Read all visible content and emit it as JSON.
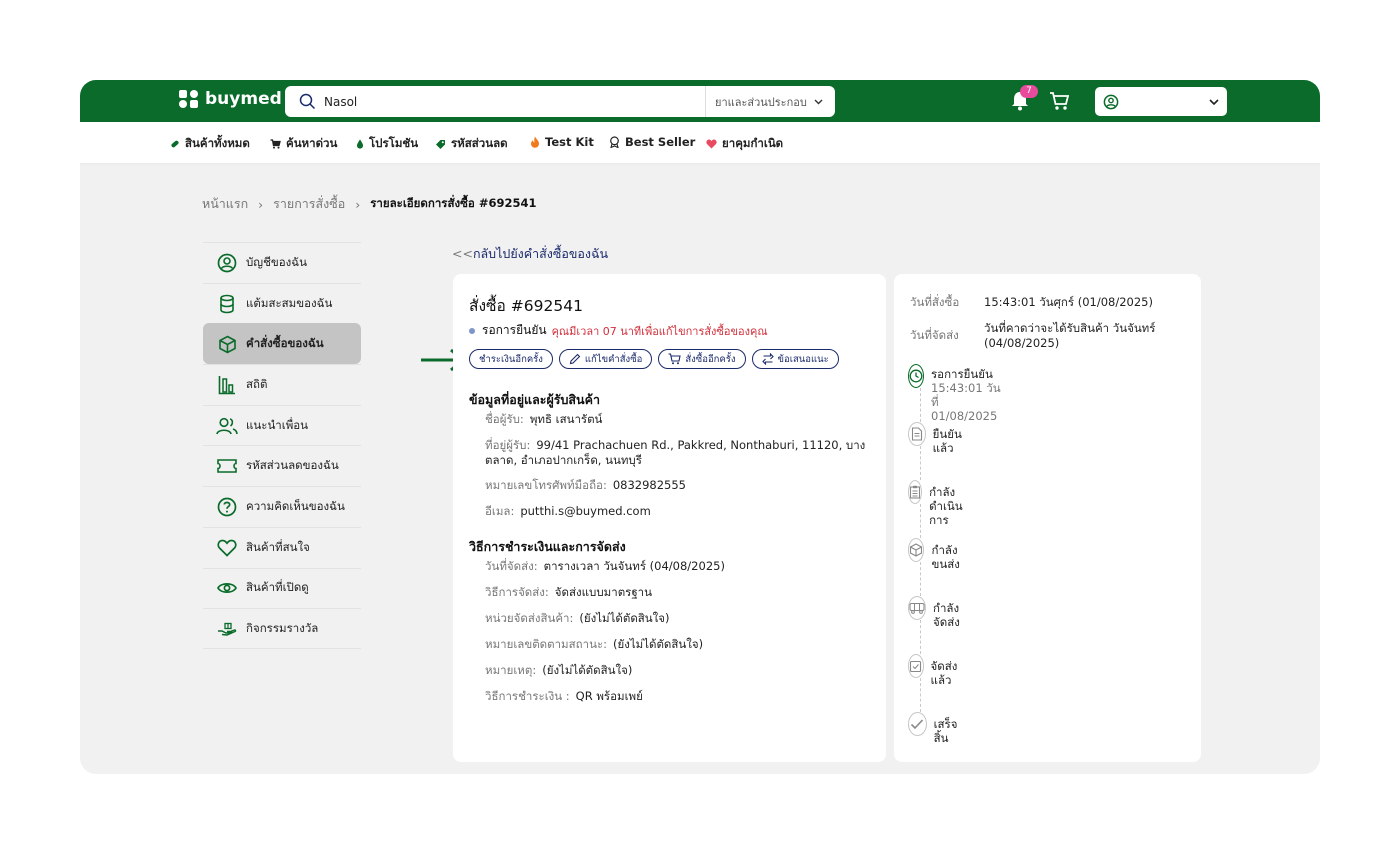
{
  "header": {
    "logo_text": "buymed",
    "search_value": "Nasol",
    "search_category": "ยาและส่วนประกอบ",
    "notification_count": "7"
  },
  "nav": {
    "items": [
      {
        "label": "สินค้าทั้งหมด",
        "icon": "pill-icon"
      },
      {
        "label": "ค้นหาด่วน",
        "icon": "cart-icon"
      },
      {
        "label": "โปรโมชัน",
        "icon": "drop-icon"
      },
      {
        "label": "รหัสส่วนลด",
        "icon": "coupon-icon"
      },
      {
        "label": "Test Kit",
        "icon": "fire-icon"
      },
      {
        "label": "Best Seller",
        "icon": "medal-icon"
      },
      {
        "label": "ยาคุมกำเนิด",
        "icon": "heart-icon"
      }
    ]
  },
  "breadcrumb": {
    "home": "หน้าแรก",
    "orders": "รายการสั่งซื้อ",
    "current": "รายละเอียดการสั่งซื้อ #692541"
  },
  "sidebar": {
    "items": [
      {
        "label": "บัญชีของฉัน",
        "icon": "user-icon"
      },
      {
        "label": "แต้มสะสมของฉัน",
        "icon": "coins-icon"
      },
      {
        "label": "คำสั่งซื้อของฉัน",
        "icon": "box-icon",
        "active": true
      },
      {
        "label": "สถิติ",
        "icon": "chart-icon"
      },
      {
        "label": "แนะนำเพื่อน",
        "icon": "users-icon"
      },
      {
        "label": "รหัสส่วนลดของฉัน",
        "icon": "ticket-icon"
      },
      {
        "label": "ความคิดเห็นของฉัน",
        "icon": "question-icon"
      },
      {
        "label": "สินค้าที่สนใจ",
        "icon": "heart-icon"
      },
      {
        "label": "สินค้าที่เปิดดู",
        "icon": "eye-icon"
      },
      {
        "label": "กิจกรรมรางวัล",
        "icon": "gift-hand-icon"
      }
    ]
  },
  "back_link": {
    "prefix": "<<",
    "label": "กลับไปยังคำสั่งซื้อของฉัน"
  },
  "order": {
    "title": "สั่งซื้อ #692541",
    "status": "รอการยืนยัน",
    "status_note": "คุณมีเวลา 07 นาทีเพื่อแก้ไขการสั่งซื้อของคุณ",
    "actions": {
      "pay_again": "ชำระเงินอีกครั้ง",
      "edit": "แก้ไขคำสั่งซื้อ",
      "reorder": "สั่งซื้ออีกครั้ง",
      "feedback": "ข้อเสนอแนะ"
    },
    "address_section": {
      "title": "ข้อมูลที่อยู่และผู้รับสินค้า",
      "recipient_label": "ชื่อผู้รับ:",
      "recipient": "พุทธิ เสนารัตน์",
      "address_label": "ที่อยู่ผู้รับ:",
      "address": "99/41 Prachachuen Rd., Pakkred, Nonthaburi, 11120, บางตลาด, อำเภอปากเกร็ด, นนทบุรี",
      "phone_label": "หมายเลขโทรศัพท์มือถือ:",
      "phone": "0832982555",
      "email_label": "อีเมล:",
      "email": "putthi.s@buymed.com"
    },
    "payment_section": {
      "title": "วิธีการชำระเงินและการจัดส่ง",
      "delivery_date_label": "วันที่จัดส่ง:",
      "delivery_date": "ตารางเวลา วันจันทร์ (04/08/2025)",
      "shipping_method_label": "วิธีการจัดส่ง:",
      "shipping_method": "จัดส่งแบบมาตรฐาน",
      "carrier_label": "หน่วยจัดส่งสินค้า:",
      "carrier": "(ยังไม่ได้ตัดสินใจ)",
      "tracking_label": "หมายเลขติดตามสถานะ:",
      "tracking": "(ยังไม่ได้ตัดสินใจ)",
      "note_label": "หมายเหตุ:",
      "note": "(ยังไม่ได้ตัดสินใจ)",
      "payment_method_label": "วิธีการชำระเงิน :",
      "payment_method": "QR พร้อมเพย์"
    }
  },
  "summary": {
    "order_date_label": "วันที่สั่งซื้อ",
    "order_date": "15:43:01 วันศุกร์ (01/08/2025)",
    "delivery_label": "วันที่จัดส่ง",
    "delivery": "วันที่คาดว่าจะได้รับสินค้า วันจันทร์ (04/08/2025)",
    "timeline": [
      {
        "label": "รอการยืนยัน",
        "sub": "15:43:01 วันที่ 01/08/2025",
        "icon": "clock-icon",
        "done": true
      },
      {
        "label": "ยืนยันแล้ว",
        "icon": "document-icon"
      },
      {
        "label": "กำลังดำเนินการ",
        "icon": "clipboard-icon"
      },
      {
        "label": "กำลังขนส่ง",
        "icon": "box-icon"
      },
      {
        "label": "กำลังจัดส่ง",
        "icon": "truck-icon"
      },
      {
        "label": "จัดส่งแล้ว",
        "icon": "checkbox-icon"
      },
      {
        "label": "เสร็จสิ้น",
        "icon": "check-icon"
      }
    ]
  },
  "colors": {
    "brand_green": "#0a6b2a",
    "navy": "#1b2a6b",
    "alert_red": "#d22e3a",
    "badge_pink": "#e94b9c"
  }
}
